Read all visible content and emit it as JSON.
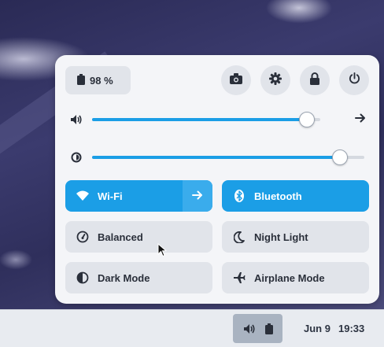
{
  "panel": {
    "battery": {
      "percent_label": "98 %",
      "icon": "battery-icon"
    },
    "actions": [
      {
        "name": "screenshot",
        "icon": "camera-icon"
      },
      {
        "name": "settings",
        "icon": "gear-icon"
      },
      {
        "name": "lock",
        "icon": "lock-icon"
      },
      {
        "name": "power",
        "icon": "power-icon"
      }
    ],
    "volume": {
      "icon": "speaker-icon",
      "level_percent": 94
    },
    "brightness": {
      "icon": "brightness-icon",
      "level_percent": 91
    },
    "toggles": {
      "wifi": {
        "label": "Wi-Fi",
        "active": true
      },
      "bluetooth": {
        "label": "Bluetooth",
        "active": true
      },
      "power_mode": {
        "label": "Balanced",
        "active": false
      },
      "night_light": {
        "label": "Night Light",
        "active": false
      },
      "dark_mode": {
        "label": "Dark Mode",
        "active": false
      },
      "airplane_mode": {
        "label": "Airplane Mode",
        "active": false
      }
    }
  },
  "taskbar": {
    "date": "Jun 9",
    "time": "19:33"
  },
  "colors": {
    "accent": "#1b9ee6",
    "panel_bg": "#f4f5f8",
    "tile_bg": "#e1e4ea"
  }
}
